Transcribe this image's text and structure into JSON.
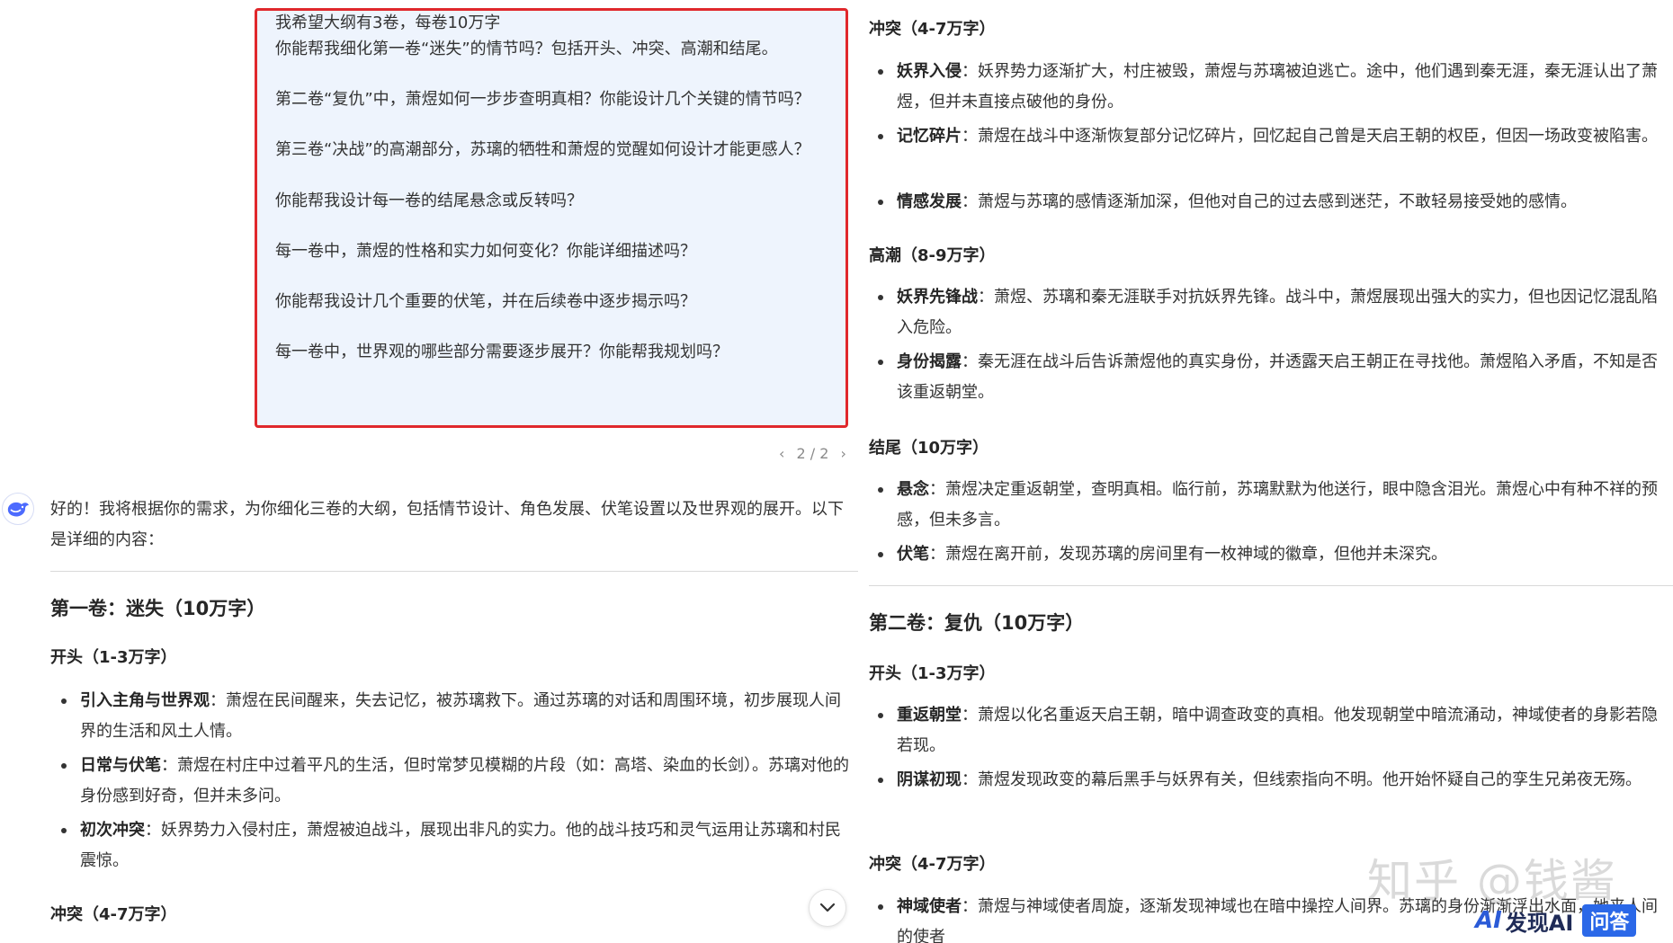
{
  "user_message": {
    "lines": [
      "我希望大纲有3卷，每卷10万字",
      "你能帮我细化第一卷“迷失”的情节吗？包括开头、冲突、高潮和结尾。",
      "第二卷“复仇”中，萧煜如何一步步查明真相？你能设计几个关键的情节吗？",
      "第三卷“决战”的高潮部分，苏璃的牺牲和萧煜的觉醒如何设计才能更感人？",
      "你能帮我设计每一卷的结尾悬念或反转吗？",
      "每一卷中，萧煜的性格和实力如何变化？你能详细描述吗？",
      "你能帮我设计几个重要的伏笔，并在后续卷中逐步揭示吗？",
      "每一卷中，世界观的哪些部分需要逐步展开？你能帮我规划吗？"
    ]
  },
  "pager": {
    "prev": "‹",
    "text": "2 / 2",
    "next": "›"
  },
  "reply": {
    "intro": "好的！我将根据你的需求，为你细化三卷的大纲，包括情节设计、角色发展、伏笔设置以及世界观的展开。以下是详细的内容：",
    "vol1_title": "第一卷：迷失（10万字）",
    "vol1_opening": {
      "heading": "开头（1-3万字）",
      "items": [
        {
          "term": "引入主角与世界观",
          "text": "：萧煜在民间醒来，失去记忆，被苏璃救下。通过苏璃的对话和周围环境，初步展现人间界的生活和风土人情。"
        },
        {
          "term": "日常与伏笔",
          "text": "：萧煜在村庄中过着平凡的生活，但时常梦见模糊的片段（如：高塔、染血的长剑）。苏璃对他的身份感到好奇，但并未多问。"
        },
        {
          "term": "初次冲突",
          "text": "：妖界势力入侵村庄，萧煜被迫战斗，展现出非凡的实力。他的战斗技巧和灵气运用让苏璃和村民震惊。"
        }
      ]
    },
    "vol1_conflict_heading_left": "冲突（4-7万字）",
    "vol1_conflict": {
      "heading": "冲突（4-7万字）",
      "items": [
        {
          "term": "妖界入侵",
          "text": "：妖界势力逐渐扩大，村庄被毁，萧煜与苏璃被迫逃亡。途中，他们遇到秦无涯，秦无涯认出了萧煜，但并未直接点破他的身份。"
        },
        {
          "term": "记忆碎片",
          "text": "：萧煜在战斗中逐渐恢复部分记忆碎片，回忆起自己曾是天启王朝的权臣，但因一场政变被陷害。"
        },
        {
          "term": "情感发展",
          "text": "：萧煜与苏璃的感情逐渐加深，但他对自己的过去感到迷茫，不敢轻易接受她的感情。"
        }
      ]
    },
    "vol1_climax": {
      "heading": "高潮（8-9万字）",
      "items": [
        {
          "term": "妖界先锋战",
          "text": "：萧煜、苏璃和秦无涯联手对抗妖界先锋。战斗中，萧煜展现出强大的实力，但也因记忆混乱陷入危险。"
        },
        {
          "term": "身份揭露",
          "text": "：秦无涯在战斗后告诉萧煜他的真实身份，并透露天启王朝正在寻找他。萧煜陷入矛盾，不知是否该重返朝堂。"
        }
      ]
    },
    "vol1_ending": {
      "heading": "结尾（10万字）",
      "items": [
        {
          "term": "悬念",
          "text": "：萧煜决定重返朝堂，查明真相。临行前，苏璃默默为他送行，眼中隐含泪光。萧煜心中有种不祥的预感，但未多言。"
        },
        {
          "term": "伏笔",
          "text": "：萧煜在离开前，发现苏璃的房间里有一枚神域的徽章，但他并未深究。"
        }
      ]
    },
    "vol2_title": "第二卷：复仇（10万字）",
    "vol2_opening": {
      "heading": "开头（1-3万字）",
      "items": [
        {
          "term": "重返朝堂",
          "text": "：萧煜以化名重返天启王朝，暗中调查政变的真相。他发现朝堂中暗流涌动，神域使者的身影若隐若现。"
        },
        {
          "term": "阴谋初现",
          "text": "：萧煜发现政变的幕后黑手与妖界有关，但线索指向不明。他开始怀疑自己的孪生兄弟夜无殇。"
        }
      ]
    },
    "vol2_conflict": {
      "heading": "冲突（4-7万字）",
      "items": [
        {
          "term": "神域使者",
          "text": "：萧煜与神域使者周旋，逐渐发现神域也在暗中操控人间界。苏璃的身份渐渐浮出水面，她来人间的使者"
        }
      ]
    }
  },
  "watermark": "知乎 @钱酱",
  "badge": {
    "ai": "AI",
    "name": "发现AI",
    "ask": "问答"
  }
}
